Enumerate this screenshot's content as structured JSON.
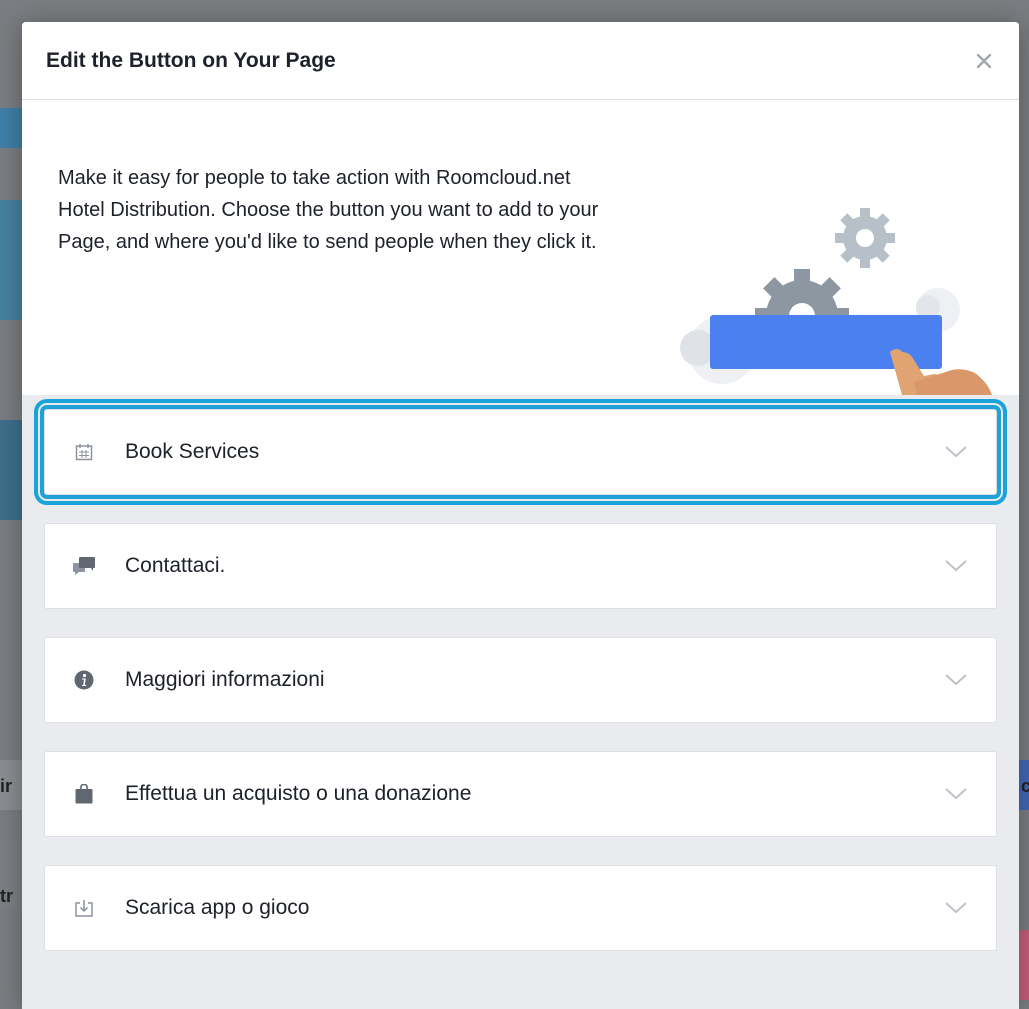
{
  "dialog": {
    "title": "Edit the Button on Your Page",
    "close_label": "×",
    "intro": "Make it easy for people to take action with Roomcloud.net Hotel Distribution. Choose the button you want to add to your Page, and where you'd like to send people when they click it."
  },
  "background": {
    "letters": [
      "ir",
      "c",
      "tr"
    ]
  },
  "options": [
    {
      "label": "Book Services",
      "icon": "calendar-icon",
      "selected": true
    },
    {
      "label": "Contattaci.",
      "icon": "chat-bubbles-icon",
      "selected": false
    },
    {
      "label": "Maggiori informazioni",
      "icon": "info-icon",
      "selected": false
    },
    {
      "label": "Effettua un acquisto o una donazione",
      "icon": "shopping-bag-icon",
      "selected": false
    },
    {
      "label": "Scarica app o gioco",
      "icon": "download-icon",
      "selected": false
    }
  ],
  "colors": {
    "selection_outline": "#1aa3db",
    "illustration_button": "#4a80f0",
    "gear": "#8c97a1",
    "hand": "#e0a473"
  }
}
